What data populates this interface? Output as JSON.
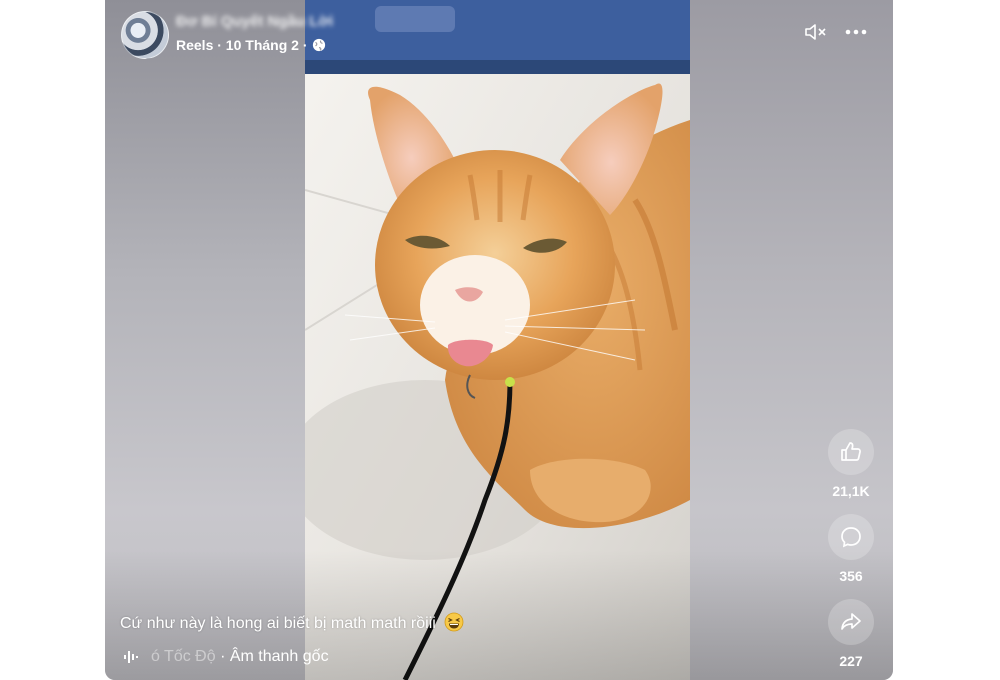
{
  "header": {
    "page_name": "Đơ Bí Quyết Ngầu Lời",
    "meta": "Reels · 10 Tháng 2 ·",
    "privacy_icon": "globe-icon"
  },
  "controls": {
    "mute_icon": "speaker-muted-icon",
    "more_icon": "more-dots-icon"
  },
  "actions": {
    "like_count": "21,1K",
    "comment_count": "356",
    "share_count": "227",
    "like_icon": "thumbs-up-icon",
    "comment_icon": "comment-bubble-icon",
    "share_icon": "share-arrow-icon"
  },
  "caption": {
    "text": "Cứ như này là hong ai biết bị math math rồiii",
    "emoji": "grinning-squint-face"
  },
  "audio": {
    "icon": "sound-wave-icon",
    "faded_prefix": "ó Tốc Độ",
    "label": " · Âm thanh gốc"
  },
  "colors": {
    "overlay_text": "#ffffff",
    "background_side": "#b7b6bc",
    "cat_orange": "#e8a55a"
  }
}
